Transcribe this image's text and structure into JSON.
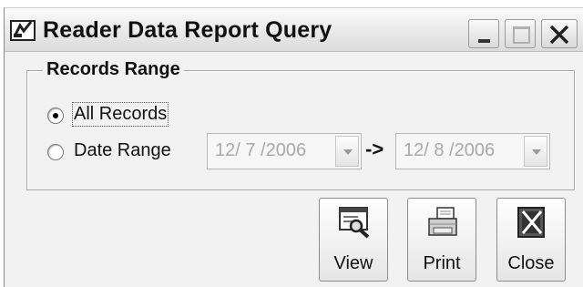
{
  "window": {
    "title": "Reader Data Report Query"
  },
  "group": {
    "label": "Records Range"
  },
  "options": {
    "all_records": "All Records",
    "date_range": "Date Range",
    "selected": "all_records"
  },
  "dates": {
    "from": "12/ 7 /2006",
    "to": "12/ 8 /2006",
    "separator": "->"
  },
  "buttons": {
    "view": "View",
    "print": "Print",
    "close": "Close"
  }
}
